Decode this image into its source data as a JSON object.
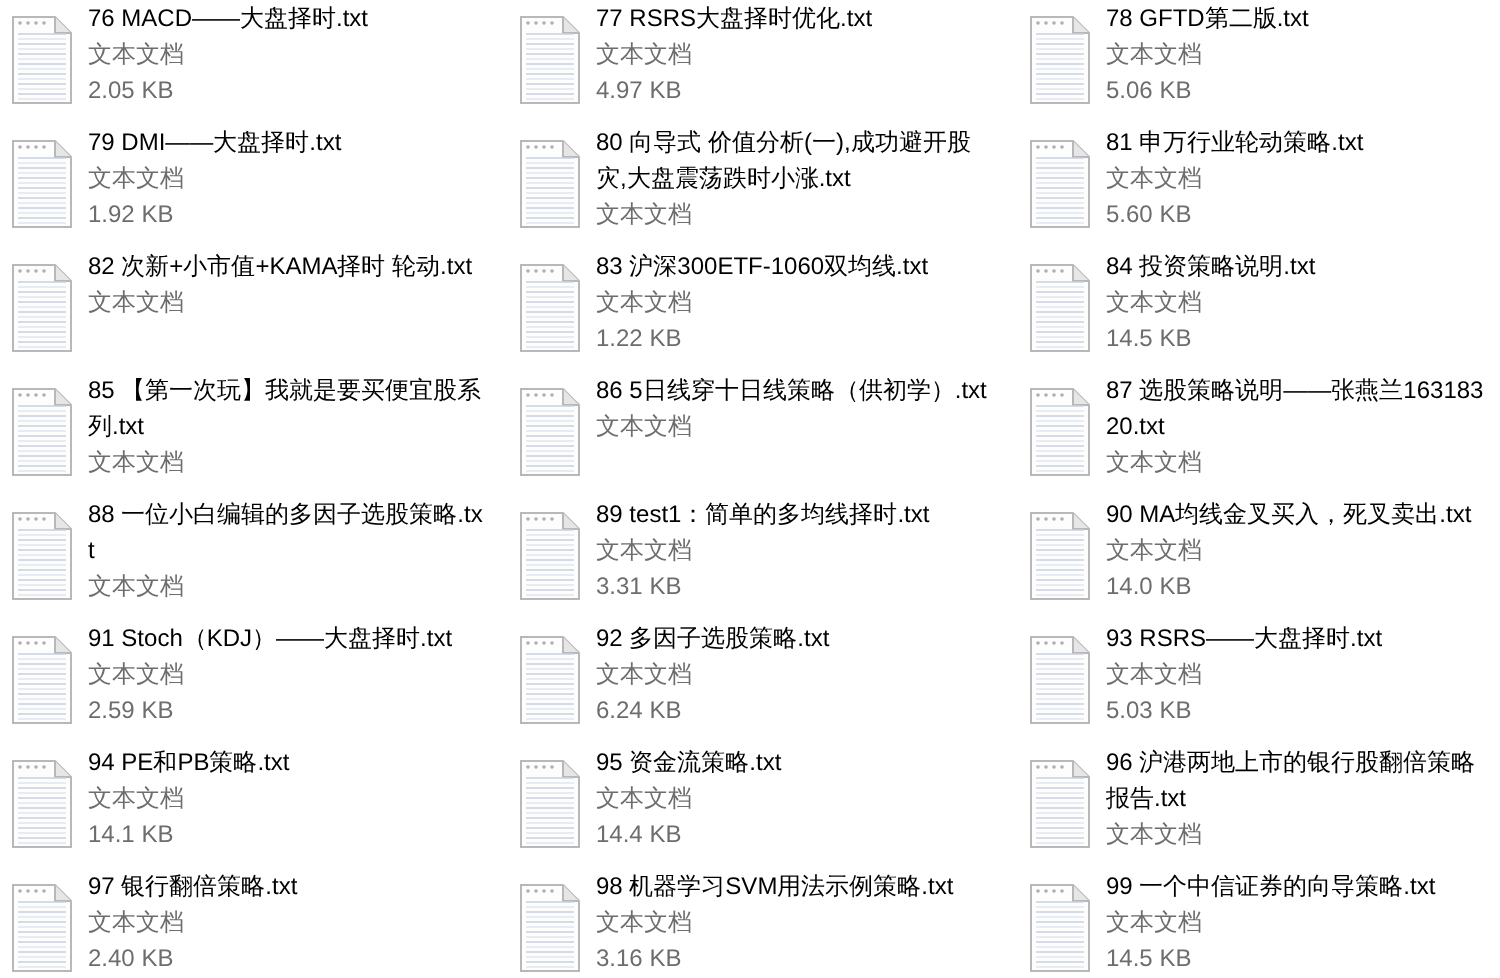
{
  "files": [
    {
      "name": "76 MACD——大盘择时.txt",
      "type": "文本文档",
      "size": "2.05 KB"
    },
    {
      "name": "77 RSRS大盘择时优化.txt",
      "type": "文本文档",
      "size": "4.97 KB"
    },
    {
      "name": "78 GFTD第二版.txt",
      "type": "文本文档",
      "size": "5.06 KB"
    },
    {
      "name": "79 DMI——大盘择时.txt",
      "type": "文本文档",
      "size": "1.92 KB"
    },
    {
      "name": "80 向导式 价值分析(一),成功避开股灾,大盘震荡跌时小涨.txt",
      "type": "文本文档"
    },
    {
      "name": "81 申万行业轮动策略.txt",
      "type": "文本文档",
      "size": "5.60 KB"
    },
    {
      "name": "82 次新+小市值+KAMA择时 轮动.txt",
      "type": "文本文档"
    },
    {
      "name": "83 沪深300ETF-1060双均线.txt",
      "type": "文本文档",
      "size": "1.22 KB"
    },
    {
      "name": "84 投资策略说明.txt",
      "type": "文本文档",
      "size": "14.5 KB"
    },
    {
      "name": "85 【第一次玩】我就是要买便宜股系列.txt",
      "type": "文本文档"
    },
    {
      "name": "86 5日线穿十日线策略（供初学）.txt",
      "type": "文本文档"
    },
    {
      "name": "87 选股策略说明——张燕兰16318320.txt",
      "type": "文本文档"
    },
    {
      "name": "88 一位小白编辑的多因子选股策略.txt",
      "type": "文本文档"
    },
    {
      "name": "89 test1：简单的多均线择时.txt",
      "type": "文本文档",
      "size": "3.31 KB"
    },
    {
      "name": "90 MA均线金叉买入，死叉卖出.txt",
      "type": "文本文档",
      "size": "14.0 KB"
    },
    {
      "name": "91 Stoch（KDJ）——大盘择时.txt",
      "type": "文本文档",
      "size": "2.59 KB"
    },
    {
      "name": "92 多因子选股策略.txt",
      "type": "文本文档",
      "size": "6.24 KB"
    },
    {
      "name": "93 RSRS——大盘择时.txt",
      "type": "文本文档",
      "size": "5.03 KB"
    },
    {
      "name": "94 PE和PB策略.txt",
      "type": "文本文档",
      "size": "14.1 KB"
    },
    {
      "name": "95 资金流策略.txt",
      "type": "文本文档",
      "size": "14.4 KB"
    },
    {
      "name": "96 沪港两地上市的银行股翻倍策略报告.txt",
      "type": "文本文档"
    },
    {
      "name": "97 银行翻倍策略.txt",
      "type": "文本文档",
      "size": "2.40 KB"
    },
    {
      "name": "98 机器学习SVM用法示例策略.txt",
      "type": "文本文档",
      "size": "3.16 KB"
    },
    {
      "name": "99 一个中信证券的向导策略.txt",
      "type": "文本文档",
      "size": "14.5 KB"
    }
  ]
}
